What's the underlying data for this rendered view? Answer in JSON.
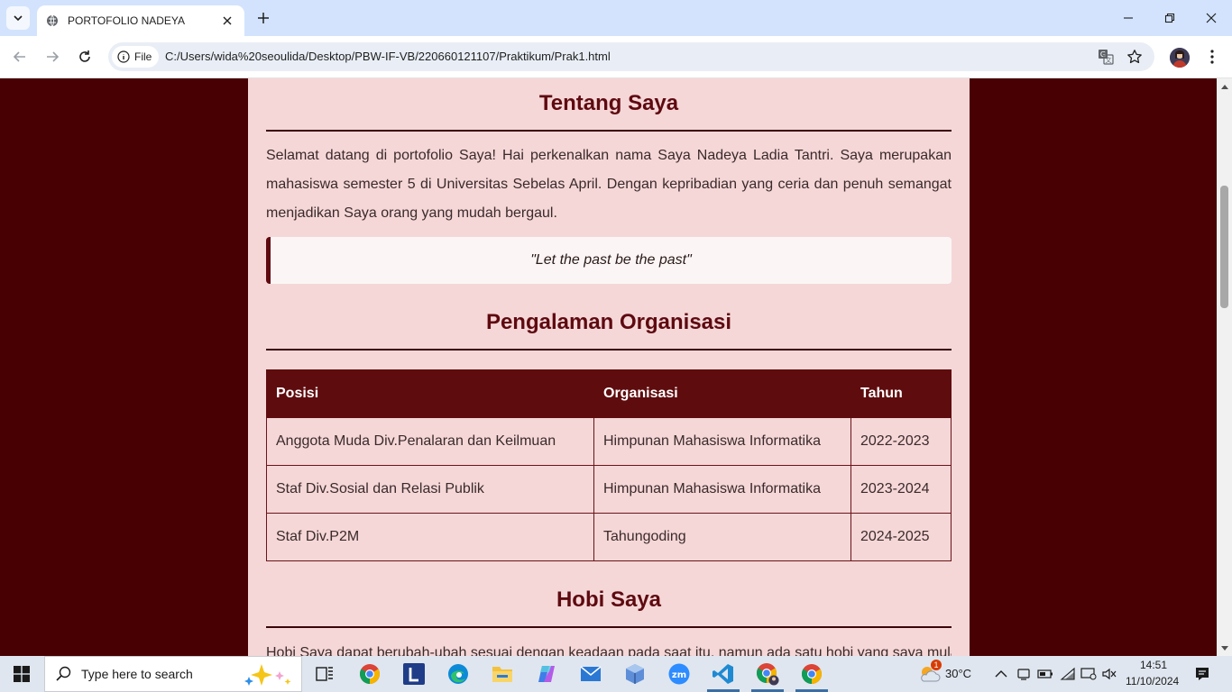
{
  "browser": {
    "tab_title": "PORTOFOLIO NADEYA",
    "site_chip_label": "File",
    "url": "C:/Users/wida%20seoulida/Desktop/PBW-IF-VB/220660121107/Praktikum/Prak1.html"
  },
  "page": {
    "about": {
      "title": "Tentang Saya",
      "text": "Selamat datang di portofolio Saya! Hai perkenalkan nama Saya Nadeya Ladia Tantri. Saya merupakan mahasiswa semester 5 di Universitas Sebelas April. Dengan kepribadian yang ceria dan penuh semangat menjadikan Saya orang yang mudah bergaul.",
      "quote": "\"Let the past be the past\""
    },
    "organization": {
      "title": "Pengalaman Organisasi",
      "headers": [
        "Posisi",
        "Organisasi",
        "Tahun"
      ],
      "rows": [
        [
          "Anggota Muda Div.Penalaran dan Keilmuan",
          "Himpunan Mahasiswa Informatika",
          "2022-2023"
        ],
        [
          "Staf Div.Sosial dan Relasi Publik",
          "Himpunan Mahasiswa Informatika",
          "2023-2024"
        ],
        [
          "Staf Div.P2M",
          "Tahungoding",
          "2024-2025"
        ]
      ]
    },
    "hobby": {
      "title": "Hobi Saya",
      "text": "Hobi Saya dapat berubah-ubah sesuai dengan keadaan pada saat itu, namun ada satu hobi yang saya mulai"
    }
  },
  "colors": {
    "page_bg": "#480002",
    "container_bg": "#f5d7d8",
    "accent": "#5e0a10",
    "table_header": "#5f0c0e"
  },
  "taskbar": {
    "search_placeholder": "Type here to search",
    "weather": "30°C",
    "weather_badge": "1",
    "time": "14:51",
    "date": "11/10/2024",
    "apps": [
      "task-view",
      "chrome",
      "l-app",
      "edge",
      "file-explorer",
      "copilot",
      "mail",
      "virtualbox",
      "zoom",
      "vscode",
      "chrome-profile",
      "chrome"
    ]
  }
}
